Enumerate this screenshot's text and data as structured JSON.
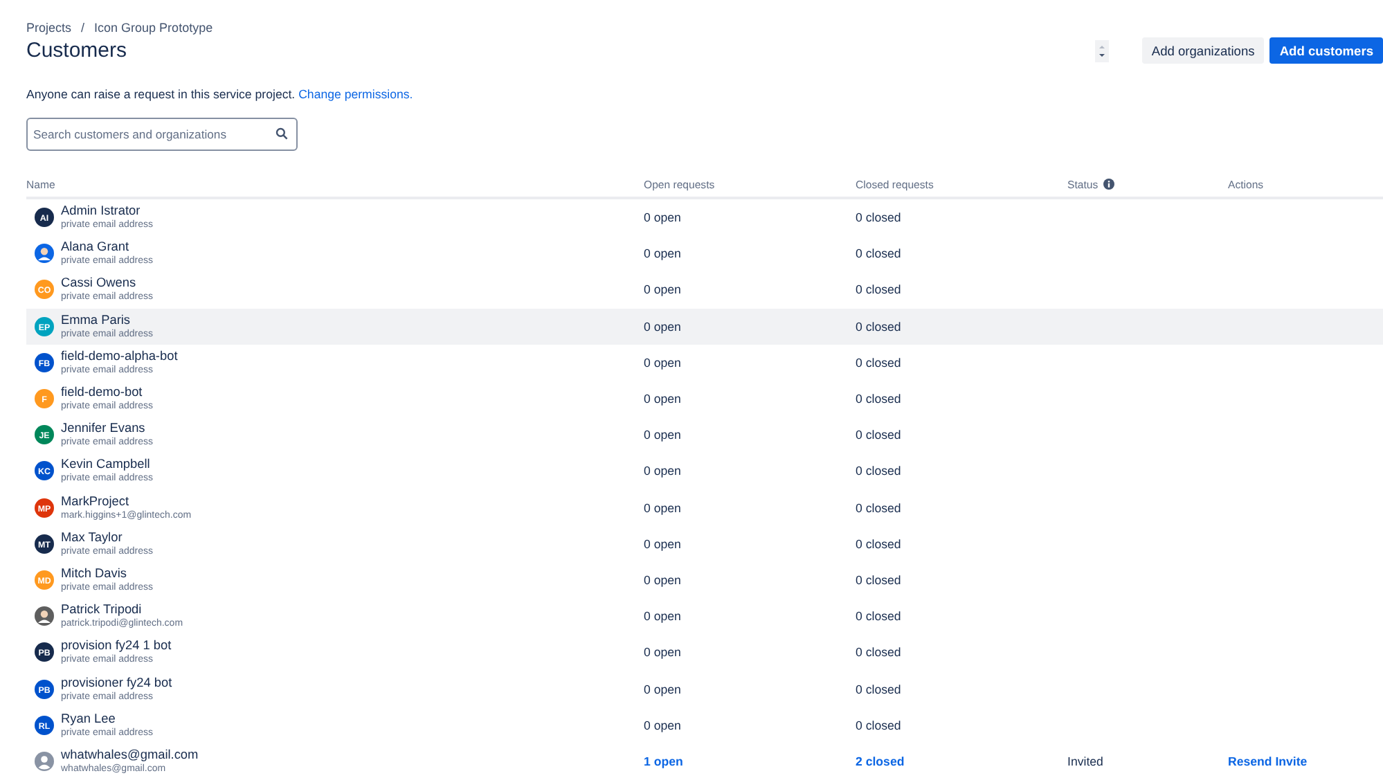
{
  "breadcrumbs": {
    "items": [
      "Projects",
      "Icon Group Prototype"
    ],
    "separator": "/"
  },
  "title": "Customers",
  "buttons": [
    {
      "label": "Add organizations",
      "kind": "secondary"
    },
    {
      "label": "Add customers",
      "kind": "primary"
    }
  ],
  "notice": {
    "text": "Anyone can raise a request in this service project.",
    "link": "Change permissions."
  },
  "search": {
    "placeholder": "Search customers and organizations"
  },
  "table": {
    "columns": [
      "Name",
      "Open requests",
      "Closed requests",
      "Status",
      "Actions"
    ],
    "rows": [
      {
        "name": "Admin Istrator",
        "email": "private email address",
        "avatar": {
          "kind": "initials",
          "text": "AI",
          "color": "#172b4d"
        },
        "open": "0 open",
        "closed": "0 closed",
        "selected": false
      },
      {
        "name": "Alana Grant",
        "email": "private email address",
        "avatar": {
          "kind": "photo",
          "color": "#0c66e4"
        },
        "open": "0 open",
        "closed": "0 closed",
        "selected": false
      },
      {
        "name": "Cassi Owens",
        "email": "private email address",
        "avatar": {
          "kind": "initials",
          "text": "CO",
          "color": "#ff991f"
        },
        "open": "0 open",
        "closed": "0 closed",
        "selected": false
      },
      {
        "name": "Emma Paris",
        "email": "private email address",
        "avatar": {
          "kind": "initials",
          "text": "EP",
          "color": "#00a3bf"
        },
        "open": "0 open",
        "closed": "0 closed",
        "selected": true
      },
      {
        "name": "field-demo-alpha-bot",
        "email": "private email address",
        "avatar": {
          "kind": "initials",
          "text": "FB",
          "color": "#0052cc"
        },
        "open": "0 open",
        "closed": "0 closed",
        "selected": false
      },
      {
        "name": "field-demo-bot",
        "email": "private email address",
        "avatar": {
          "kind": "initials",
          "text": "F",
          "color": "#ff991f"
        },
        "open": "0 open",
        "closed": "0 closed",
        "selected": false
      },
      {
        "name": "Jennifer Evans",
        "email": "private email address",
        "avatar": {
          "kind": "initials",
          "text": "JE",
          "color": "#00875a"
        },
        "open": "0 open",
        "closed": "0 closed",
        "selected": false
      },
      {
        "name": "Kevin Campbell",
        "email": "private email address",
        "avatar": {
          "kind": "initials",
          "text": "KC",
          "color": "#0052cc"
        },
        "open": "0 open",
        "closed": "0 closed",
        "selected": false
      },
      {
        "name": "MarkProject",
        "email": "mark.higgins+1@glintech.com",
        "avatar": {
          "kind": "initials",
          "text": "MP",
          "color": "#de350b"
        },
        "open": "0 open",
        "closed": "0 closed",
        "selected": false
      },
      {
        "name": "Max Taylor",
        "email": "private email address",
        "avatar": {
          "kind": "initials",
          "text": "MT",
          "color": "#172b4d"
        },
        "open": "0 open",
        "closed": "0 closed",
        "selected": false
      },
      {
        "name": "Mitch Davis",
        "email": "private email address",
        "avatar": {
          "kind": "initials",
          "text": "MD",
          "color": "#ff991f"
        },
        "open": "0 open",
        "closed": "0 closed",
        "selected": false
      },
      {
        "name": "Patrick Tripodi",
        "email": "patrick.tripodi@glintech.com",
        "avatar": {
          "kind": "photo",
          "color": "#5e5e5e"
        },
        "open": "0 open",
        "closed": "0 closed",
        "selected": false
      },
      {
        "name": "provision fy24 1 bot",
        "email": "private email address",
        "avatar": {
          "kind": "initials",
          "text": "PB",
          "color": "#172b4d"
        },
        "open": "0 open",
        "closed": "0 closed",
        "selected": false
      },
      {
        "name": "provisioner fy24 bot",
        "email": "private email address",
        "avatar": {
          "kind": "initials",
          "text": "PB",
          "color": "#0052cc"
        },
        "open": "0 open",
        "closed": "0 closed",
        "selected": false
      },
      {
        "name": "Ryan Lee",
        "email": "private email address",
        "avatar": {
          "kind": "initials",
          "text": "RL",
          "color": "#0052cc"
        },
        "open": "0 open",
        "closed": "0 closed",
        "selected": false
      },
      {
        "name": "whatwhales@gmail.com",
        "email": "whatwhales@gmail.com",
        "avatar": {
          "kind": "default",
          "color": "#8993a4"
        },
        "open": "1 open",
        "closed": "2 closed",
        "open_linked": true,
        "closed_linked": true,
        "status": "Invited",
        "action": "Resend Invite",
        "selected": false
      }
    ]
  }
}
